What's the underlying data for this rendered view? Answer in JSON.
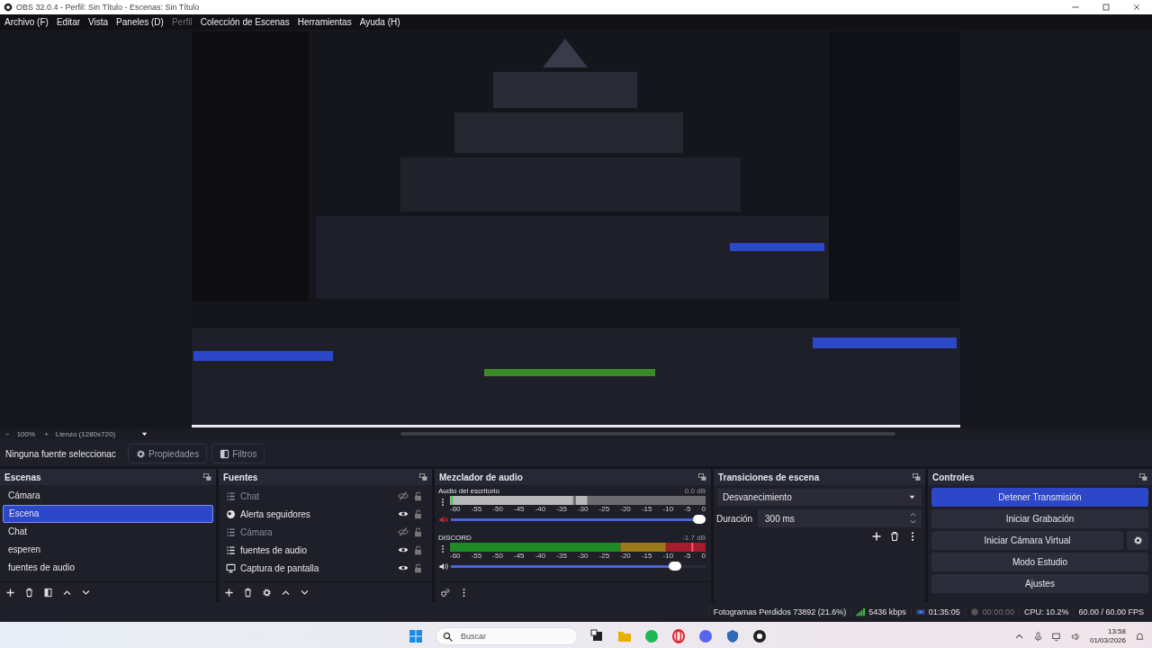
{
  "window": {
    "title": "OBS 32.0.4 - Perfil: Sin Título - Escenas: Sin Título"
  },
  "menu": [
    {
      "label": "Archivo (F)",
      "disabled": false
    },
    {
      "label": "Editar",
      "disabled": false
    },
    {
      "label": "Vista",
      "disabled": false
    },
    {
      "label": "Paneles (D)",
      "disabled": false
    },
    {
      "label": "Perfil",
      "disabled": true
    },
    {
      "label": "Colección de Escenas",
      "disabled": false
    },
    {
      "label": "Herramientas",
      "disabled": false
    },
    {
      "label": "Ayuda (H)",
      "disabled": false
    }
  ],
  "zoom_bar": {
    "zoom_out": "−",
    "zoom": "100%",
    "zoom_in": "+",
    "canvas": "Lienzo (1280x720)"
  },
  "source_toolbar": {
    "label": "Ninguna fuente seleccionac",
    "properties": "Propiedades",
    "filters": "Filtros"
  },
  "scenes": {
    "title": "Escenas",
    "items": [
      {
        "name": "Cámara",
        "selected": false
      },
      {
        "name": "Escena",
        "selected": true
      },
      {
        "name": "Chat",
        "selected": false
      },
      {
        "name": "esperen",
        "selected": false
      },
      {
        "name": "fuentes de audio",
        "selected": false
      }
    ]
  },
  "sources": {
    "title": "Fuentes",
    "items": [
      {
        "name": "Chat",
        "kind": "group",
        "visible": false
      },
      {
        "name": "Alerta seguidores",
        "kind": "browser",
        "visible": true
      },
      {
        "name": "Cámara",
        "kind": "group",
        "visible": false
      },
      {
        "name": "fuentes de audio",
        "kind": "group",
        "visible": true
      },
      {
        "name": "Captura de pantalla",
        "kind": "display",
        "visible": true
      }
    ]
  },
  "mixer": {
    "title": "Mezclador de audio",
    "channels": [
      {
        "name": "Audio del escritorio",
        "reading": "0.0 dB",
        "muted": true,
        "level": 1.0,
        "scale": [
          "-60",
          "-55",
          "-50",
          "-45",
          "-40",
          "-35",
          "-30",
          "-25",
          "-20",
          "-15",
          "-10",
          "-5",
          "0"
        ]
      },
      {
        "name": "DISCORD",
        "reading": "-1.7 dB",
        "muted": false,
        "level": 0.9,
        "scale": [
          "-60",
          "-55",
          "-50",
          "-45",
          "-40",
          "-35",
          "-30",
          "-25",
          "-20",
          "-15",
          "-10",
          "-5",
          "0"
        ]
      }
    ]
  },
  "transitions": {
    "title": "Transiciones de escena",
    "transition": "Desvanecimiento",
    "duration_label": "Duración",
    "duration": "300 ms"
  },
  "controls": {
    "title": "Controles",
    "buttons": [
      {
        "label": "Detener Transmisión",
        "active": true,
        "settings": false
      },
      {
        "label": "Iniciar Grabación",
        "active": false,
        "settings": false
      },
      {
        "label": "Iniciar Cámara Virtual",
        "active": false,
        "settings": true
      },
      {
        "label": "Modo Estudio",
        "active": false,
        "settings": false
      },
      {
        "label": "Ajustes",
        "active": false,
        "settings": false
      }
    ]
  },
  "status_bar": {
    "dropped_frames": "Fotogramas Perdidos 73892 (21.6%)",
    "bitrate": "5436 kbps",
    "stream_time": "01:35:05",
    "record_time": "00:00:00",
    "cpu": "CPU: 10.2%",
    "fps": "60.00 / 60.00 FPS"
  },
  "taskbar": {
    "search_placeholder": "Buscar",
    "time": "13:58",
    "date": "01/03/2026"
  }
}
